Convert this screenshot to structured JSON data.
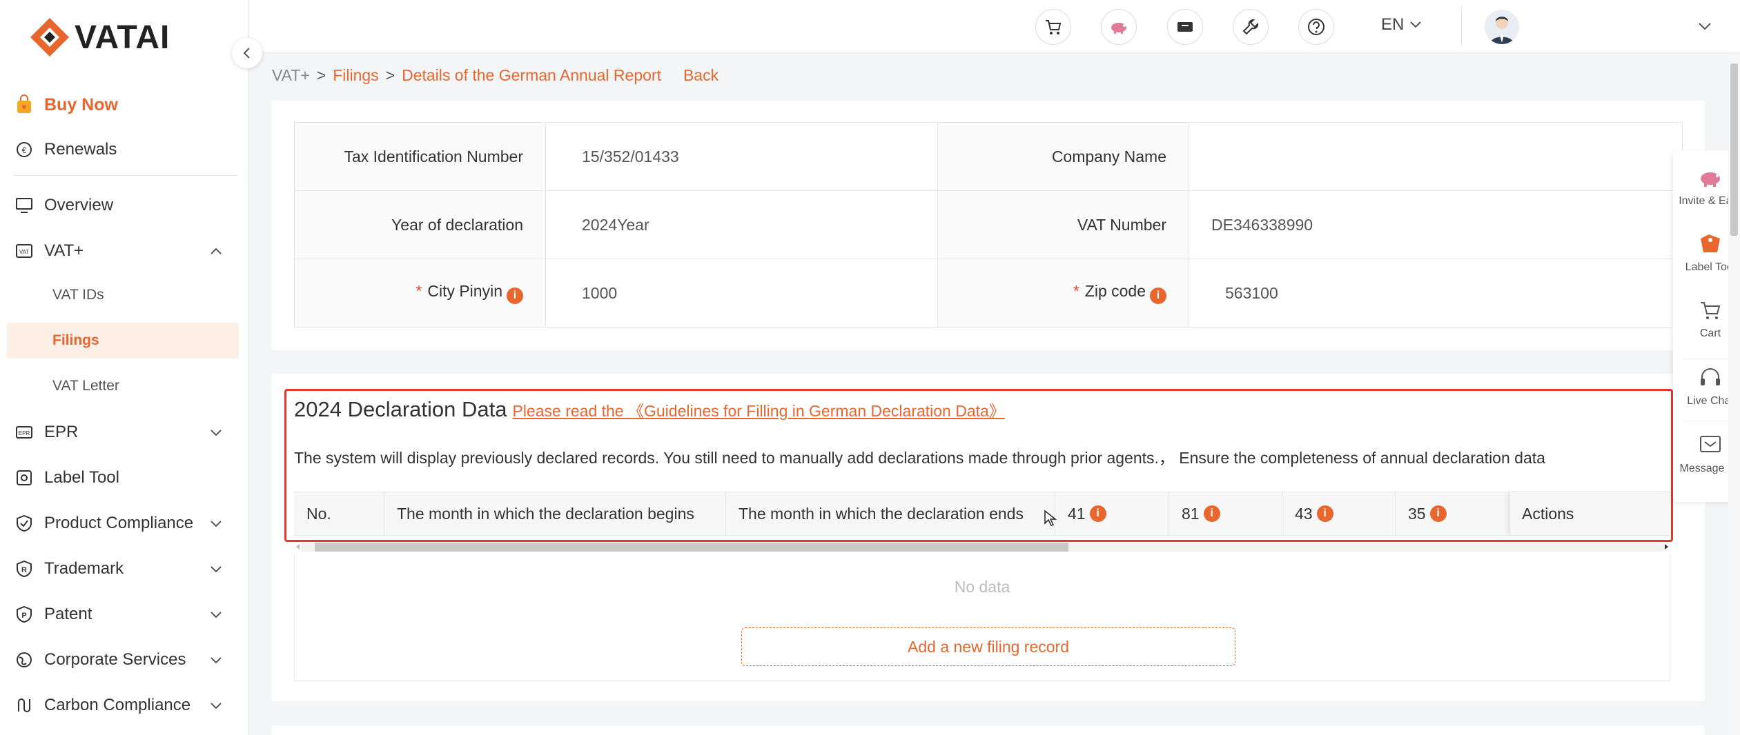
{
  "brand": {
    "name": "VATAI",
    "accent": "#e8672f"
  },
  "sidebar": {
    "buy_now": "Buy Now",
    "renewals": "Renewals",
    "items": [
      {
        "label": "Overview",
        "icon": "monitor-icon"
      },
      {
        "label": "VAT+",
        "icon": "vat-icon",
        "expanded": true
      },
      {
        "label": "EPR",
        "icon": "epr-icon"
      },
      {
        "label": "Label Tool",
        "icon": "label-icon"
      },
      {
        "label": "Product Compliance",
        "icon": "shield-icon"
      },
      {
        "label": "Trademark",
        "icon": "trademark-icon"
      },
      {
        "label": "Patent",
        "icon": "patent-icon"
      },
      {
        "label": "Corporate Services",
        "icon": "globe-icon"
      },
      {
        "label": "Carbon Compliance",
        "icon": "carbon-icon"
      }
    ],
    "vat_sub": [
      "VAT IDs",
      "Filings",
      "VAT Letter"
    ],
    "active_sub": "Filings"
  },
  "header": {
    "language": "EN"
  },
  "breadcrumb": {
    "root": "VAT+",
    "sep": ">",
    "filings": "Filings",
    "current": "Details of the German Annual Report",
    "back": "Back"
  },
  "info": {
    "tax_id_label": "Tax Identification Number",
    "tax_id_value": "15/352/01433",
    "company_label": "Company Name",
    "company_value": "",
    "year_label": "Year of declaration",
    "year_value": "2024Year",
    "vat_label": "VAT Number",
    "vat_value": "DE346338990",
    "city_label": "City Pinyin",
    "city_value": "1000",
    "zip_label": "Zip code",
    "zip_value": "563100",
    "required_mark": "*",
    "info_glyph": "i"
  },
  "declaration": {
    "title": "2024 Declaration Data",
    "guide_link": "Please read the 《Guidelines for Filling in German Declaration Data》",
    "note": "The system will display previously declared records. You still need to manually add declarations made through prior agents.， Ensure the completeness of annual declaration data",
    "columns": [
      "No.",
      "The month in which the declaration begins",
      "The month in which the declaration ends",
      "41",
      "81",
      "43",
      "35",
      "Actions"
    ],
    "empty_text": "No data",
    "add_button": "Add a new filing record"
  },
  "float_bar": {
    "invite": "Invite & Earn",
    "label_tool": "Label Tool",
    "cart": "Cart",
    "live_chat": "Live Chat",
    "message": "Message Us"
  }
}
